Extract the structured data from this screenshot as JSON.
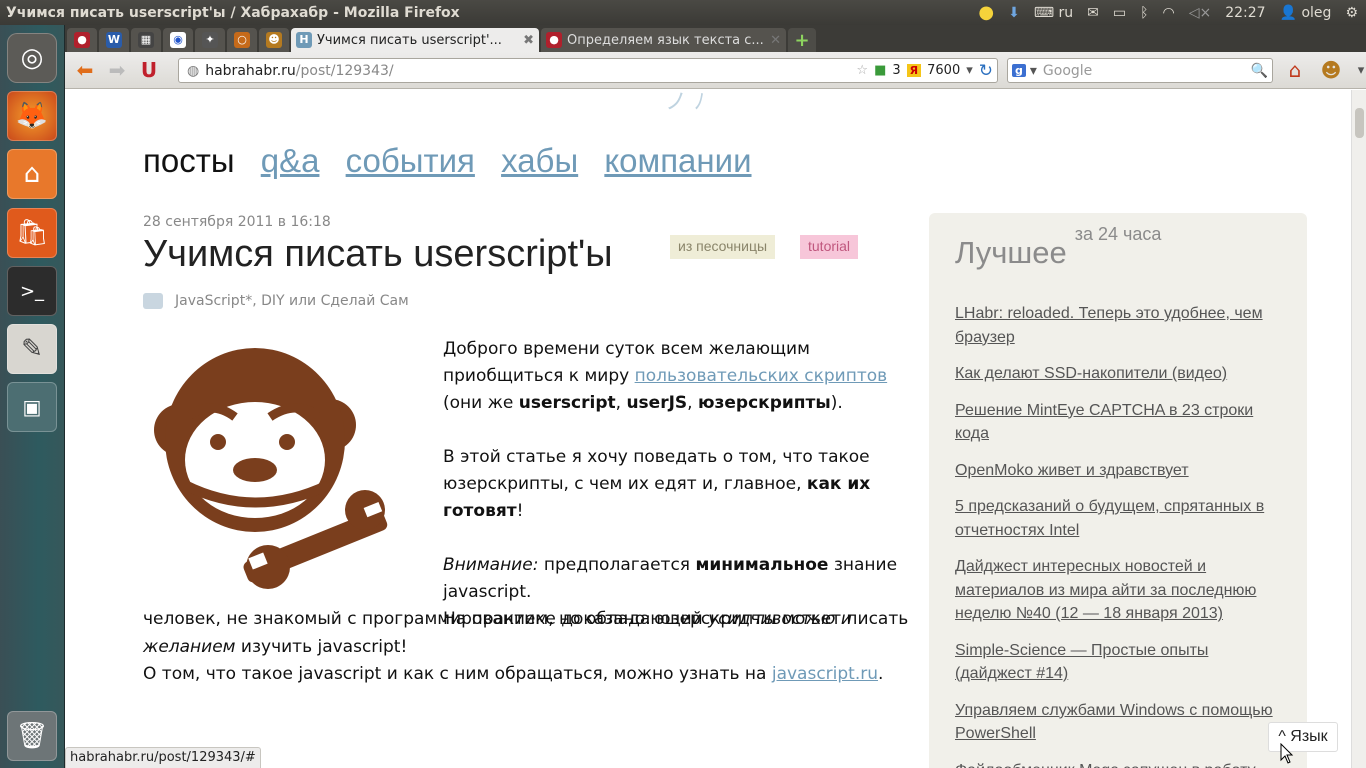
{
  "window_title": "Учимся писать userscript'ы / Хабрахабр - Mozilla Firefox",
  "panel": {
    "keyboard": "ru",
    "clock": "22:27",
    "user": "oleg"
  },
  "tabs": [
    {
      "label": "Учимся писать userscript'...",
      "active": true
    },
    {
      "label": "Определяем язык текста с...",
      "active": false
    }
  ],
  "nav": {
    "url_host": "habrahabr.ru",
    "url_path": "/post/129343/",
    "pr_count": "3",
    "yandex_count": "7600",
    "search_placeholder": "Google"
  },
  "site_menu": {
    "current": "посты",
    "links": [
      "q&a",
      "события",
      "хабы",
      "компании"
    ]
  },
  "post": {
    "date": "28 сентября 2011 в 16:18",
    "title": "Учимся писать userscript'ы",
    "tag_sandbox": "из песочницы",
    "tag_tutorial": "tutorial",
    "hub1": "JavaScript",
    "hub1_mark": "*",
    "hub_sep": ",",
    "hub2": "DIY или Сделай Сам",
    "p1_a": "Доброго времени суток всем желающим приобщиться к миру ",
    "p1_link": "пользовательских скриптов",
    "p1_b": " (они же ",
    "p1_c": "userscript",
    "p1_d": ", ",
    "p1_e": "userJS",
    "p1_f": ", ",
    "p1_g": "юзерскрипты",
    "p1_h": ").",
    "p2_a": "В этой статье я хочу поведать о том, что такое юзерскрипты, с чем их едят и, главное, ",
    "p2_b": "как их готовят",
    "p2_c": "!",
    "p3_a": "Внимание:",
    "p3_b": " предполагается ",
    "p3_c": "минимальное",
    "p3_d": " знание javascript.",
    "p4_a": "На практике доказано: юзерскрипты может писать",
    "p4_b": "человек, не знакомый с программированием, но обладающий ",
    "p4_c": "усидчивостью и желанием",
    "p4_d": " изучить javascript!",
    "p5_a": "О том, что такое javascript и как с ним обращаться, можно узнать на ",
    "p5_link": "javascript.ru",
    "p5_b": "."
  },
  "sidebar": {
    "title": "Лучшее",
    "period": "за 24 часа",
    "items": [
      "LHabr: reloaded. Теперь это удобнее, чем браузер",
      "Как делают SSD-накопители (видео)",
      "Решение MintEye CAPTCHA в 23 строки кода",
      "OpenMoko живет и здравствует",
      "5 предсказаний о будущем, спрятанных в отчетностях Intel",
      "Дайджест интересных новостей и материалов из мира айти за последнюю неделю №40 (12 — 18 января 2013)",
      "Simple-Science — Простые опыты (дайджест #14)",
      "Управляем службами Windows с помощью PowerShell",
      "Файлообменник Mega запущен в работу"
    ]
  },
  "statusbar": "habrahabr.ru/post/129343/#",
  "lang_button": "^ Язык",
  "colors": {
    "link": "#6f9ab7",
    "monkey": "#7a3e1d",
    "tag_sandbox": "#efedd7",
    "tag_tutorial": "#f7c6d9"
  }
}
